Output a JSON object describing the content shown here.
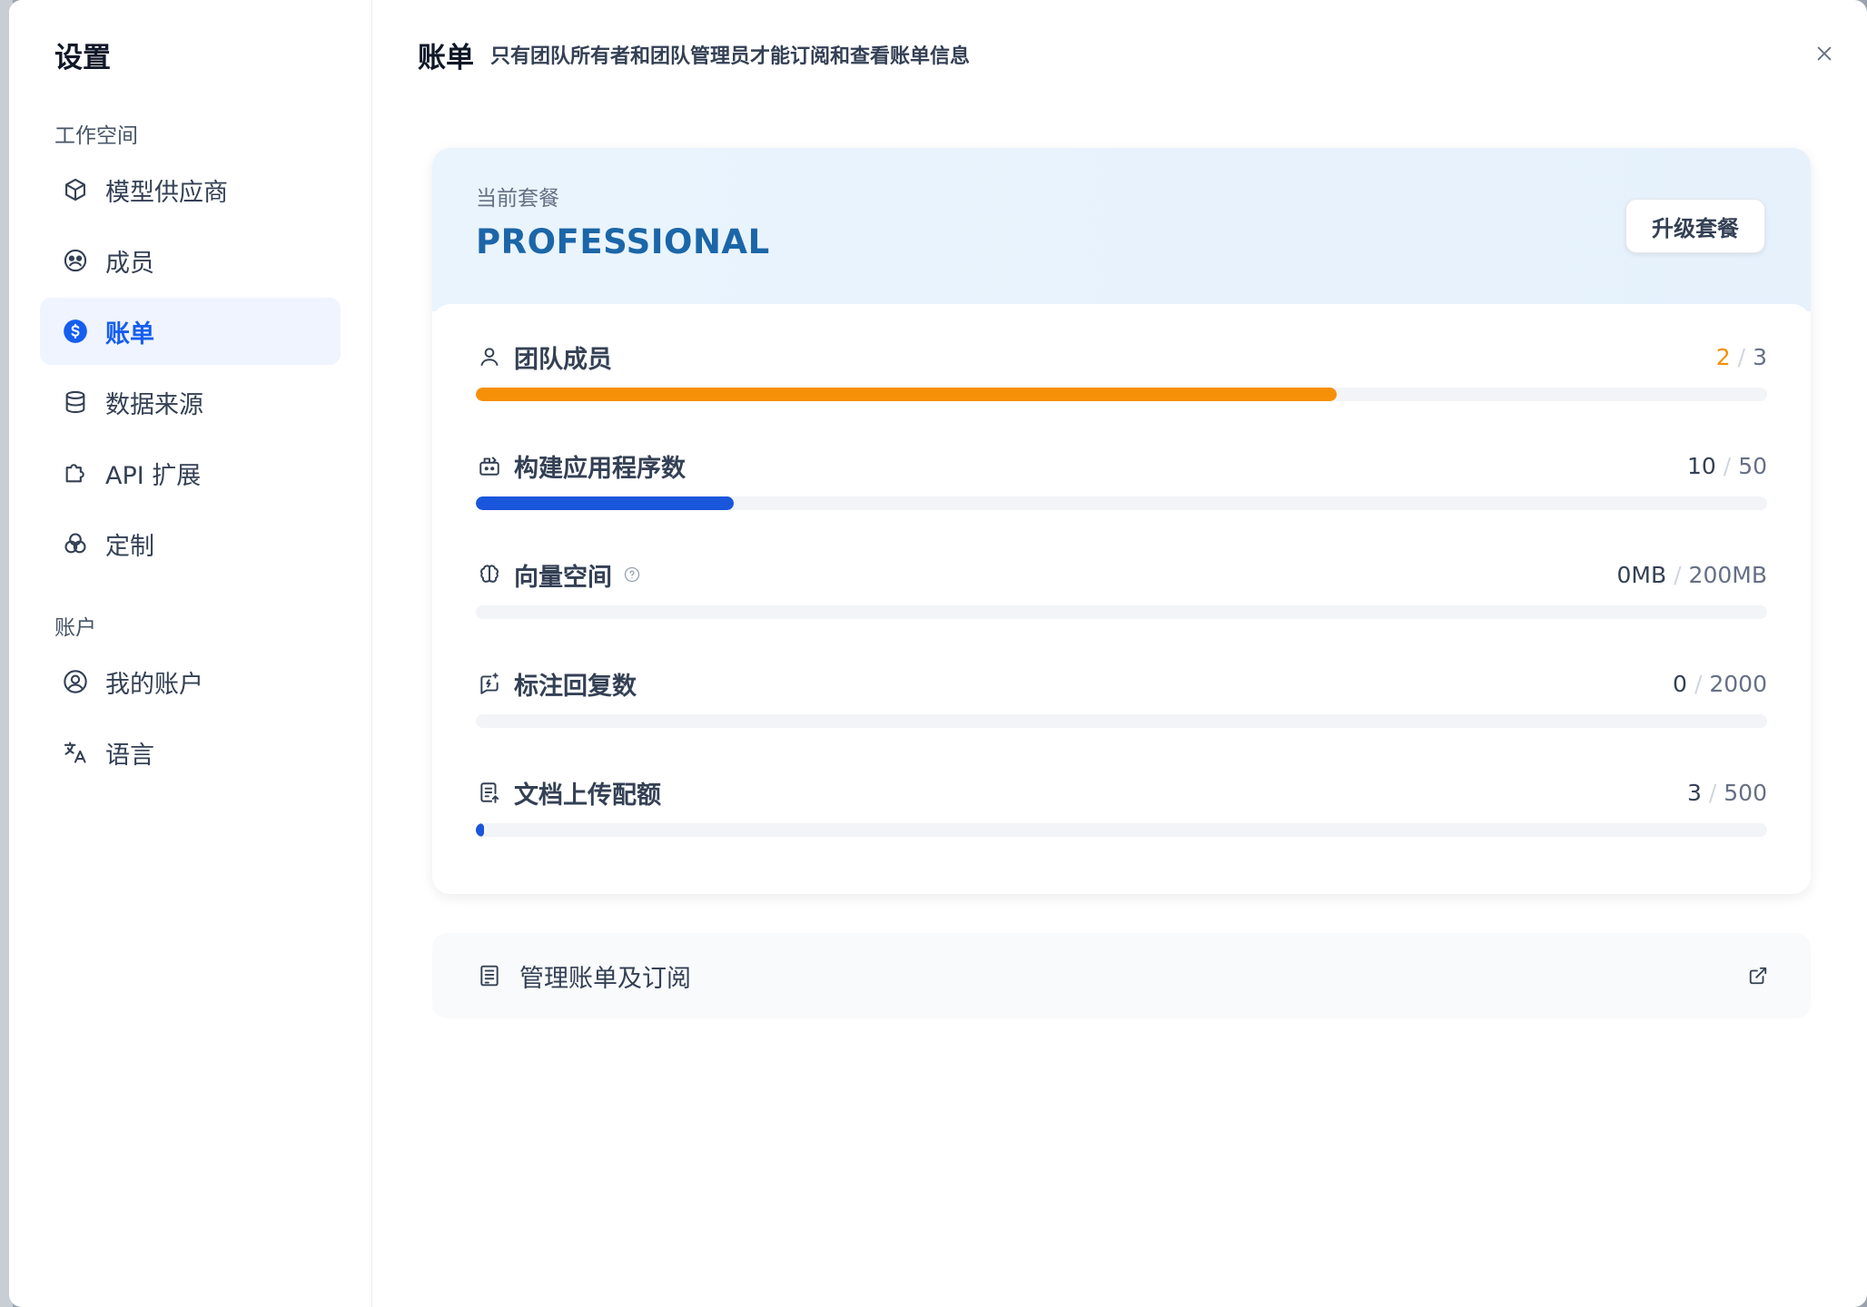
{
  "sidebar": {
    "title": "设置",
    "workspace_label": "工作空间",
    "workspace_items": [
      {
        "label": "模型供应商",
        "icon": "cube-icon"
      },
      {
        "label": "成员",
        "icon": "members-icon"
      },
      {
        "label": "账单",
        "icon": "dollar-icon",
        "active": true
      },
      {
        "label": "数据来源",
        "icon": "database-icon"
      },
      {
        "label": "API 扩展",
        "icon": "puzzle-icon"
      },
      {
        "label": "定制",
        "icon": "color-circles-icon"
      }
    ],
    "account_label": "账户",
    "account_items": [
      {
        "label": "我的账户",
        "icon": "user-circle-icon"
      },
      {
        "label": "语言",
        "icon": "translate-icon"
      }
    ]
  },
  "header": {
    "title": "账单",
    "description": "只有团队所有者和团队管理员才能订阅和查看账单信息"
  },
  "plan": {
    "label": "当前套餐",
    "name": "PROFESSIONAL",
    "upgrade_label": "升级套餐"
  },
  "usage": [
    {
      "name": "团队成员",
      "current": "2",
      "total": "3",
      "sep": "/",
      "fraction": 0.667,
      "color": "#f79009",
      "warn": true
    },
    {
      "name": "构建应用程序数",
      "current": "10",
      "total": "50",
      "sep": "/",
      "fraction": 0.2,
      "color": "#1a56db",
      "warn": false
    },
    {
      "name": "向量空间",
      "current": "0MB",
      "total": "200MB",
      "sep": "/",
      "fraction": 0,
      "color": "#1a56db",
      "warn": false,
      "help": true
    },
    {
      "name": "标注回复数",
      "current": "0",
      "total": "2000",
      "sep": "/",
      "fraction": 0,
      "color": "#1a56db",
      "warn": false
    },
    {
      "name": "文档上传配额",
      "current": "3",
      "total": "500",
      "sep": "/",
      "fraction": 0.006,
      "color": "#1a56db",
      "warn": false
    }
  ],
  "manage": {
    "label": "管理账单及订阅"
  },
  "colors": {
    "accent": "#155eef",
    "active_bg": "#eff4ff",
    "warn": "#f79009",
    "plan_name": "#1b66a8"
  }
}
